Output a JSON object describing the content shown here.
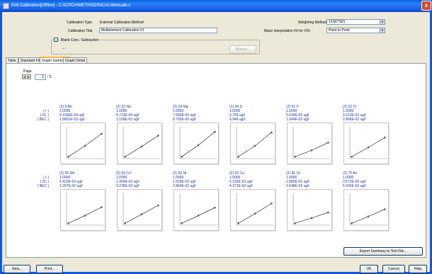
{
  "window": {
    "title": "Edit Calibration[Offline] - C:\\ICPCH\\METHODS\\ICAL\\Metcalib.c",
    "close_glyph": "x"
  },
  "form": {
    "calibration_type_label": "Calibration Type",
    "calibration_type_value": "External Calibration Method",
    "calibration_title_label": "Calibration Title",
    "calibration_title_value": "Multielement Calibration #1",
    "weighting_label": "Weighting Method",
    "weighting_value": "1/(SD*SD)",
    "mass_interp_label": "Mass Interpolation Fit for VIS:",
    "mass_interp_value": "Point to Point",
    "blank_label": "Blank Conc. Subtraction",
    "blank_value": "--",
    "browse_label": "Browse...",
    "blank_checked": false
  },
  "tabs": [
    {
      "label": "Table",
      "active": false
    },
    {
      "label": "Standard Files",
      "active": false
    },
    {
      "label": "Graph Summary",
      "active": true
    },
    {
      "label": "Graph Detail",
      "active": false
    }
  ],
  "pager": {
    "label": "Page",
    "current": "1",
    "total": "/ 3",
    "prev_glyph": "◄",
    "next_glyph": "►"
  },
  "row_labels": [
    "( r )",
    "( DL )",
    "( BEC )"
  ],
  "elements": [
    {
      "header": "(3)  9 Be",
      "r": "1.0000",
      "dl": "9.1566E-04 ug/l",
      "bec": "1.8801E-03 ug/l",
      "points": [
        [
          0.05,
          0.06
        ],
        [
          0.5,
          0.4
        ],
        [
          0.95,
          0.78
        ]
      ]
    },
    {
      "header": "(2)  23 Na",
      "r": "1.0000",
      "dl": "8.713E-04 ug/l",
      "bec": "1.158E-02 ug/l",
      "points": [
        [
          0.05,
          0.06
        ],
        [
          0.5,
          0.38
        ],
        [
          0.95,
          0.72
        ]
      ]
    },
    {
      "header": "(2)  24 Mg",
      "r": "1.0000",
      "dl": "7.583E-05 ug/l",
      "bec": "8.793E-05 ug/l",
      "points": [
        [
          0.05,
          0.06
        ],
        [
          0.5,
          0.42
        ],
        [
          0.95,
          0.84
        ]
      ]
    },
    {
      "header": "(1)  34 S",
      "r": "1.0000",
      "dl": "1.756 ug/l",
      "bec": "6.949 ug/l",
      "points": [
        [
          0.05,
          0.06
        ],
        [
          0.5,
          0.4
        ],
        [
          0.95,
          0.82
        ]
      ]
    },
    {
      "header": "(2)  51 V",
      "r": "1.0000",
      "dl": "5.034E-03 ug/l",
      "bec": "1.049E-02 ug/l",
      "points": [
        [
          0.05,
          0.06
        ],
        [
          0.5,
          0.26
        ],
        [
          0.95,
          0.5
        ]
      ]
    },
    {
      "header": "(2)  52 Cr",
      "r": "1.0000",
      "dl": "9.213E-03 ug/l",
      "bec": "2.866E-02 ug/l",
      "points": [
        [
          0.05,
          0.06
        ],
        [
          0.5,
          0.35
        ],
        [
          0.95,
          0.66
        ]
      ]
    },
    {
      "header": "(2)  55 Mn",
      "r": "1.0000",
      "dl": "6.423E-03 ug/l",
      "bec": "1.267E-02 ug/l",
      "points": [
        [
          0.05,
          0.06
        ],
        [
          0.5,
          0.3
        ],
        [
          0.95,
          0.56
        ]
      ]
    },
    {
      "header": "(2)  59 Co",
      "r": "1.0000",
      "dl": "1.459E-03 ug/l",
      "bec": "3.235E-03 ug/l",
      "points": [
        [
          0.05,
          0.06
        ],
        [
          0.5,
          0.34
        ],
        [
          0.95,
          0.62
        ]
      ]
    },
    {
      "header": "(2)  60 Ni",
      "r": "1.0000",
      "dl": "1.529E-02 ug/l",
      "bec": "2.864E-02 ug/l",
      "points": [
        [
          0.05,
          0.06
        ],
        [
          0.5,
          0.3
        ],
        [
          0.95,
          0.55
        ]
      ]
    },
    {
      "header": "(2)  63 Cu",
      "r": "1.0000",
      "dl": "5.232E-03 ug/l",
      "bec": "4.371E-02 ug/l",
      "points": [
        [
          0.05,
          0.06
        ],
        [
          0.5,
          0.36
        ],
        [
          0.95,
          0.68
        ]
      ]
    },
    {
      "header": "(2)  66 Zn",
      "r": "1.0000",
      "dl": "1.882E-01 ug/l",
      "bec": "2.648E-01 ug/l",
      "points": [
        [
          0.05,
          0.06
        ],
        [
          0.5,
          0.22
        ],
        [
          0.95,
          0.4
        ]
      ]
    },
    {
      "header": "(2)  75 As",
      "r": "1.0000",
      "dl": "3.672E-03 ug/l",
      "bec": "5.026E-03 ug/l",
      "points": [
        [
          0.05,
          0.06
        ],
        [
          0.5,
          0.27
        ],
        [
          0.95,
          0.5
        ]
      ]
    }
  ],
  "buttons": {
    "export": "Export Summary to Text File...",
    "new": "New...",
    "print": "Print...",
    "ok": "OK",
    "cancel": "Cancel",
    "help": "Help"
  },
  "colors": {
    "accent_text": "#1f2f9a",
    "titlebar": "#1258d6",
    "plot_point": "#555555"
  }
}
